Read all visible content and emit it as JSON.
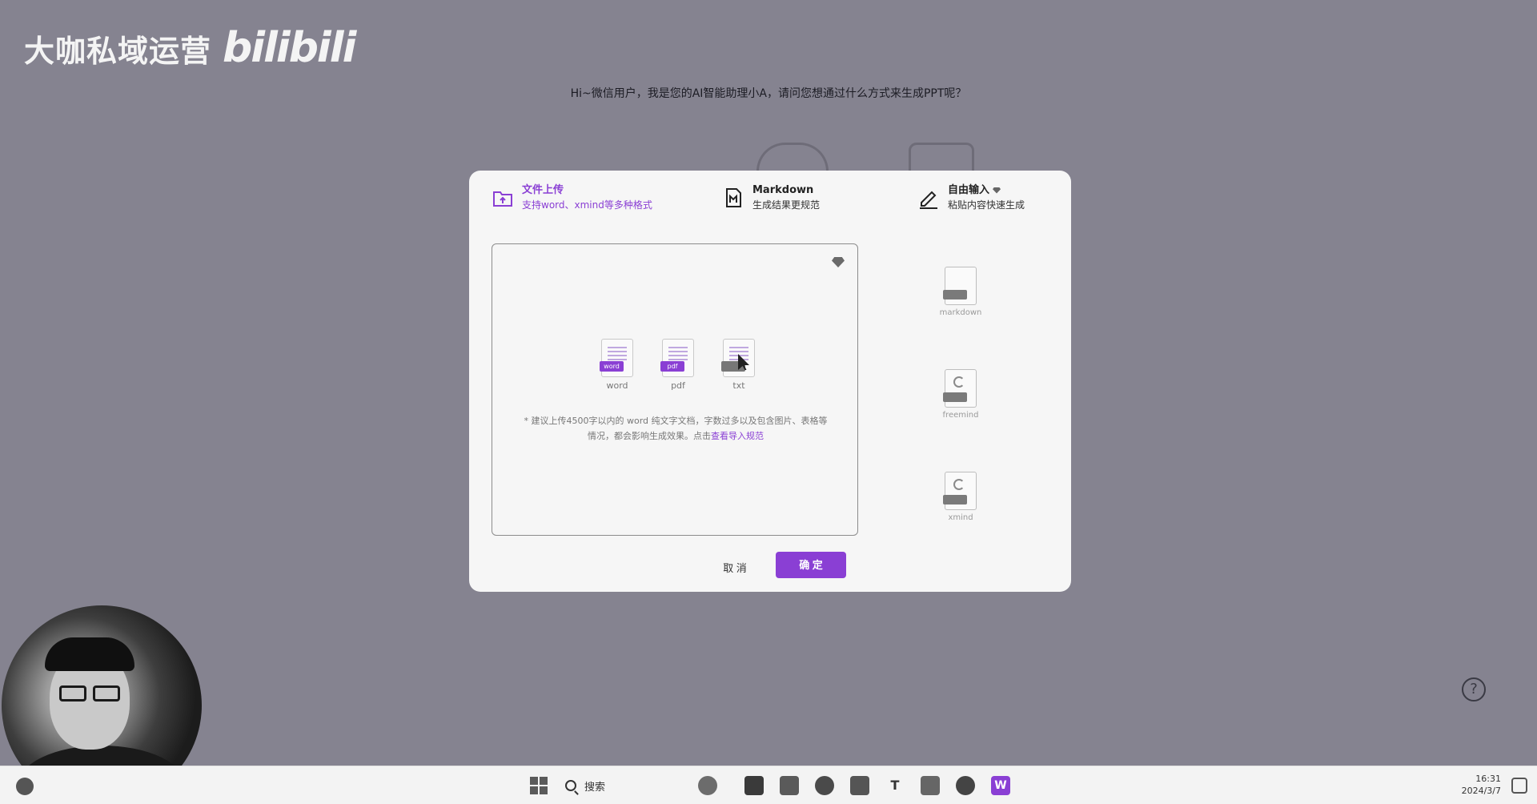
{
  "watermark": {
    "text": "大咖私域运营",
    "logo": "bilibili"
  },
  "app": {
    "greeting": "Hi~微信用户，我是您的AI智能助理小A，请问您想通过什么方式来生成PPT呢？"
  },
  "modal": {
    "tabs": [
      {
        "title": "文件上传",
        "subtitle": "支持word、xmind等多种格式",
        "icon": "folder-upload-icon",
        "active": true
      },
      {
        "title": "Markdown",
        "subtitle": "生成结果更规范",
        "icon": "markdown-icon",
        "active": false
      },
      {
        "title": "自由输入",
        "subtitle": "粘贴内容快速生成",
        "icon": "pencil-icon",
        "active": false,
        "premium": true
      }
    ],
    "upload": {
      "file_types": [
        {
          "label": "word",
          "badge": "word"
        },
        {
          "label": "pdf",
          "badge": "pdf"
        },
        {
          "label": "txt",
          "badge": ""
        }
      ],
      "hint_line1": "* 建议上传4500字以内的 word 纯文字文档，字数过多以及包含图片、表格等",
      "hint_line2": "情况，都会影响生成效果。点击",
      "hint_link": "查看导入规范"
    },
    "side_formats": [
      {
        "label": "markdown"
      },
      {
        "label": "freemind"
      },
      {
        "label": "xmind"
      }
    ],
    "buttons": {
      "cancel": "取 消",
      "confirm": "确 定"
    }
  },
  "help": {
    "label": "?"
  },
  "taskbar": {
    "search_label": "搜索",
    "pinned": [
      "copilot-icon",
      "explorer-icon",
      "edge-icon",
      "store-icon",
      "typora-icon",
      "notepad-icon",
      "app-icon",
      "wps-icon"
    ],
    "time": "16:31",
    "date": "2024/3/7"
  },
  "colors": {
    "accent": "#8a3fd4",
    "backdrop": "#858390",
    "modal_bg": "#f6f6f6"
  }
}
